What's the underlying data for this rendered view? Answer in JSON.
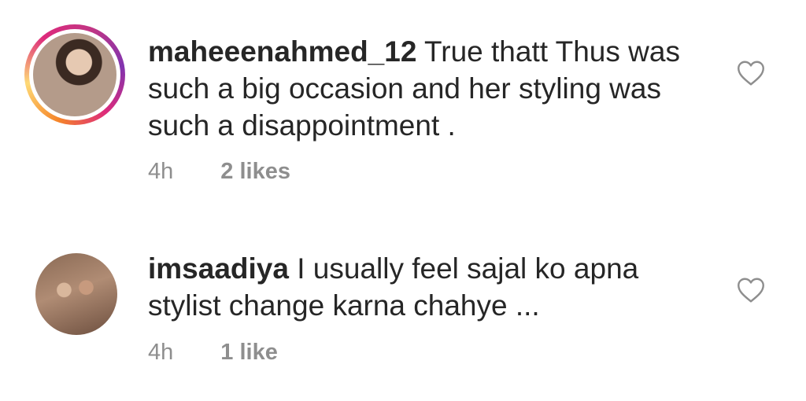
{
  "comments": [
    {
      "username": "maheeenahmed_12",
      "text": "True thatt Thus was such a big occasion and her styling was such a disappointment .",
      "time": "4h",
      "likes": "2 likes",
      "avatar_icon": "avatar-with-story-ring"
    },
    {
      "username": "imsaadiya",
      "text": "I usually feel sajal ko apna stylist change karna chahye ...",
      "time": "4h",
      "likes": "1 like",
      "avatar_icon": "avatar"
    }
  ],
  "colors": {
    "text": "#262626",
    "meta": "#8e8e8e",
    "heart_outline": "#8e8e8e",
    "story_ring_start": "#f58529",
    "story_ring_end": "#dd2a7b"
  },
  "icons": {
    "like": "heart-outline-icon"
  }
}
